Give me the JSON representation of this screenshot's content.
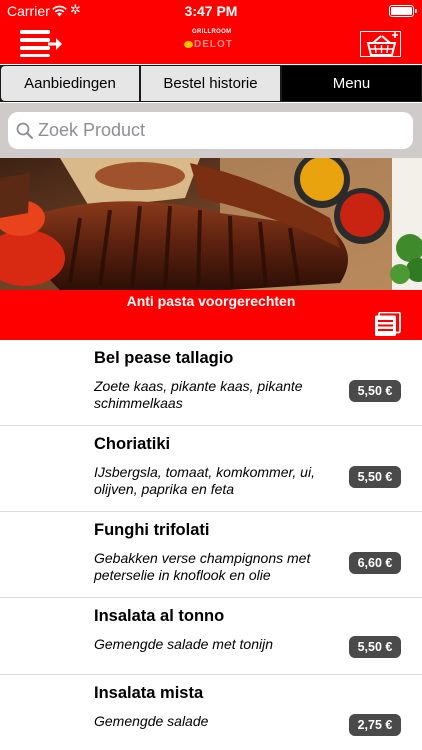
{
  "status_bar": {
    "carrier": "Carrier",
    "time": "3:47 PM"
  },
  "nav": {
    "logo_top": "GRILLROOM",
    "logo_bottom": "DELOT",
    "menu_icon": "menu-arrow-icon",
    "cart_icon": "basket-icon"
  },
  "tabs": [
    {
      "label": "Aanbiedingen",
      "active": false
    },
    {
      "label": "Bestel historie",
      "active": false
    },
    {
      "label": "Menu",
      "active": true
    }
  ],
  "search": {
    "placeholder": "Zoek Product",
    "value": ""
  },
  "category": {
    "title": "Anti pasta voorgerechten",
    "icon": "list-icon"
  },
  "items": [
    {
      "title": "Bel pease tallagio",
      "description": "Zoete kaas, pikante kaas, pikante schimmelkaas",
      "price": "5,50 €"
    },
    {
      "title": "Choriatiki",
      "description": "IJsbergsla, tomaat, komkommer, ui, olijven, paprika en feta",
      "price": "5,50 €"
    },
    {
      "title": "Funghi trifolati",
      "description": "Gebakken verse champignons met peterselie in knoflook en olie",
      "price": "6,60 €"
    },
    {
      "title": "Insalata al tonno",
      "description": "Gemengde salade met tonijn",
      "price": "5,50 €"
    },
    {
      "title": "Insalata mista",
      "description": "Gemengde salade",
      "price": "2,75 €"
    }
  ],
  "colors": {
    "brand_red": "#ff0000",
    "price_badge": "#4a4a4a",
    "search_bg": "#d0cbcb"
  }
}
